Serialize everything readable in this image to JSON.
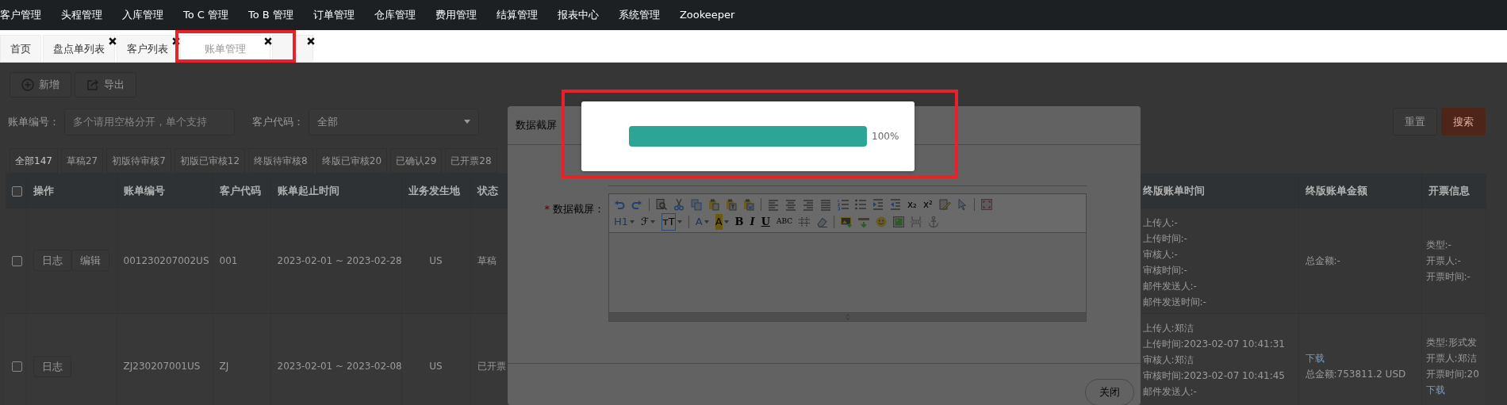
{
  "nav": {
    "items": [
      "客户管理",
      "头程管理",
      "入库管理",
      "To C 管理",
      "To B 管理",
      "订单管理",
      "仓库管理",
      "费用管理",
      "结算管理",
      "报表中心",
      "系统管理",
      "Zookeeper"
    ]
  },
  "tabs": [
    {
      "label": "首页",
      "closable": false,
      "selected": false,
      "highlighted": false
    },
    {
      "label": "盘点单列表",
      "closable": true,
      "selected": false,
      "highlighted": false
    },
    {
      "label": "客户列表",
      "closable": true,
      "selected": false,
      "highlighted": false
    },
    {
      "label": "账单管理",
      "closable": true,
      "selected": true,
      "highlighted": true
    },
    {
      "closable": true,
      "selected": false,
      "highlighted": false
    }
  ],
  "toolbar": [
    {
      "kind": "add",
      "label": "新增"
    },
    {
      "kind": "export",
      "label": "导出"
    }
  ],
  "filters": [
    {
      "kind": "text",
      "label": "账单编号：",
      "placeholder": "多个请用空格分开，单个支持"
    },
    {
      "kind": "select",
      "label": "客户代码：",
      "value": "全部"
    }
  ],
  "filter_buttons": [
    {
      "kind": "reset",
      "label": "重置"
    },
    {
      "kind": "search",
      "label": "搜索"
    }
  ],
  "status_tabs": [
    {
      "label": "全部147",
      "selected": true
    },
    {
      "label": "草稿27",
      "selected": false
    },
    {
      "label": "初版待审核7",
      "selected": false
    },
    {
      "label": "初版已审核12",
      "selected": false
    },
    {
      "label": "终版待审核8",
      "selected": false
    },
    {
      "label": "终版已审核20",
      "selected": false
    },
    {
      "label": "已确认29",
      "selected": false
    },
    {
      "label": "已开票28",
      "selected": false
    }
  ],
  "table": {
    "columns_left": [
      "操作",
      "账单编号",
      "客户代码",
      "账单起止时间",
      "业务发生地",
      "状态"
    ],
    "columns_right": [
      "终版账单时间",
      "终版账单金额",
      "开票信息"
    ],
    "header_checked": false,
    "rows": [
      {
        "checked": false,
        "actions": [
          "日志",
          "编辑"
        ],
        "cells": [
          "001230207002US",
          "001",
          "2023-02-01 ~ 2023-02-28",
          "US",
          "草稿"
        ],
        "final_time": [
          "上传人:-",
          "上传时间:-",
          "审核人:-",
          "审核时间:-",
          "邮件发送人:-",
          "邮件发送时间:-"
        ],
        "final_amount": [
          {
            "kind": "text",
            "text": "总金额:-"
          }
        ],
        "invoice": [
          {
            "kind": "text",
            "text": "类型:-"
          },
          {
            "kind": "text",
            "text": "开票人:-"
          },
          {
            "kind": "text",
            "text": "开票时间:-"
          }
        ]
      },
      {
        "checked": false,
        "actions": [
          "日志"
        ],
        "cells": [
          "ZJ230207001US",
          "ZJ",
          "2023-02-01 ~ 2023-02-08",
          "US",
          "已开票"
        ],
        "final_time": [
          "上传人:郑洁",
          "上传时间:2023-02-07 10:41:31",
          "审核人:郑洁",
          "审核时间:2023-02-07 10:41:45",
          "邮件发送人:-"
        ],
        "final_amount": [
          {
            "kind": "link",
            "text": "下载"
          },
          {
            "kind": "text",
            "text": "总金额:753811.2 USD"
          }
        ],
        "invoice": [
          {
            "kind": "text",
            "text": "类型:形式发"
          },
          {
            "kind": "text",
            "text": "开票人:郑洁"
          },
          {
            "kind": "text",
            "text": "开票时间:20"
          },
          {
            "kind": "link",
            "text": "下载"
          }
        ]
      }
    ]
  },
  "modal": {
    "title": "数据截屏",
    "field": {
      "label": "数据截屏：",
      "required_mark": "*"
    },
    "editor_toolbar": [
      [
        {
          "kind": "undo"
        },
        {
          "kind": "redo"
        },
        {
          "kind": "sep"
        },
        {
          "kind": "preview"
        },
        {
          "kind": "cut"
        },
        {
          "kind": "copy"
        },
        {
          "kind": "paste"
        },
        {
          "kind": "pastetext"
        },
        {
          "kind": "pasteword"
        },
        {
          "kind": "sep"
        },
        {
          "kind": "alignleft"
        },
        {
          "kind": "aligncenter"
        },
        {
          "kind": "alignright"
        },
        {
          "kind": "justify"
        },
        {
          "kind": "orderedlist"
        },
        {
          "kind": "bulletlist"
        },
        {
          "kind": "indent"
        },
        {
          "kind": "outdent"
        },
        {
          "kind": "subscript",
          "label": "x₂"
        },
        {
          "kind": "superscript",
          "label": "x²"
        },
        {
          "kind": "edit"
        },
        {
          "kind": "cursor"
        },
        {
          "kind": "sep"
        },
        {
          "kind": "fullscreen"
        }
      ],
      [
        {
          "kind": "heading",
          "label": "H1",
          "dropdown": true
        },
        {
          "kind": "fontfamily",
          "label": "ℱ",
          "dropdown": true
        },
        {
          "kind": "fontsize",
          "label": "ᴛT",
          "dropdown": true
        },
        {
          "kind": "sep"
        },
        {
          "kind": "fontcolor",
          "label": "A",
          "dropdown": true
        },
        {
          "kind": "highlight",
          "label": "A",
          "dropdown": true
        },
        {
          "kind": "bold",
          "label": "B"
        },
        {
          "kind": "italic",
          "label": "I"
        },
        {
          "kind": "underline",
          "label": "U"
        },
        {
          "kind": "strike",
          "label": "ABC"
        },
        {
          "kind": "table"
        },
        {
          "kind": "eraser"
        },
        {
          "kind": "sep"
        },
        {
          "kind": "insertimage"
        },
        {
          "kind": "hr"
        },
        {
          "kind": "emoticon"
        },
        {
          "kind": "picture"
        },
        {
          "kind": "pagebreak"
        },
        {
          "kind": "anchor"
        }
      ]
    ],
    "close_button": "关闭"
  },
  "progress": {
    "level": 1,
    "reading": "100%",
    "highlighted": true
  }
}
